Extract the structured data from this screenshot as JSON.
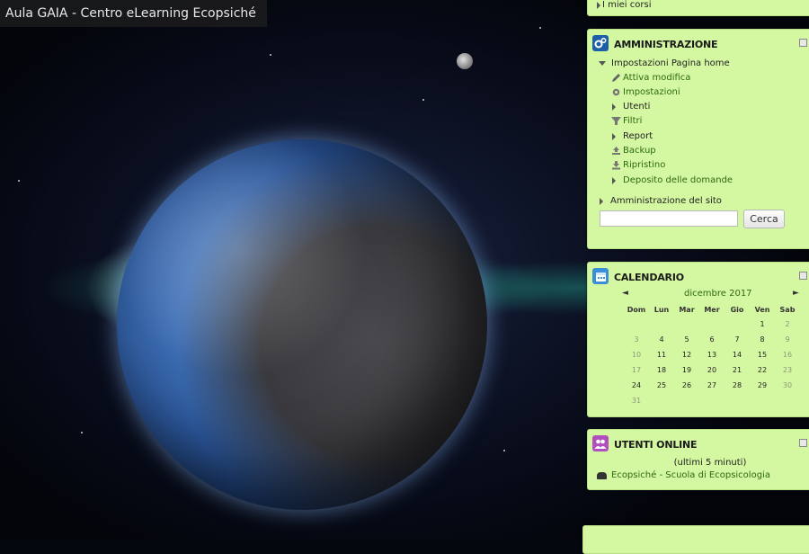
{
  "site_title": "Aula GAIA - Centro eLearning Ecopsiché",
  "top_block": {
    "link": "I miei corsi"
  },
  "admin": {
    "title": "AMMINISTRAZIONE",
    "section": "Impostazioni Pagina home",
    "items": [
      {
        "label": "Attiva modifica",
        "icon": "pencil-icon",
        "type": "link"
      },
      {
        "label": "Impostazioni",
        "icon": "gear-icon",
        "type": "link"
      },
      {
        "label": "Utenti",
        "icon": "arrow-right-icon",
        "type": "plain"
      },
      {
        "label": "Filtri",
        "icon": "filter-icon",
        "type": "link"
      },
      {
        "label": "Report",
        "icon": "arrow-right-icon",
        "type": "plain"
      },
      {
        "label": "Backup",
        "icon": "upload-icon",
        "type": "link"
      },
      {
        "label": "Ripristino",
        "icon": "download-icon",
        "type": "link"
      },
      {
        "label": "Deposito delle domande",
        "icon": "arrow-right-icon",
        "type": "link"
      }
    ],
    "site_admin": "Amministrazione del sito",
    "search": {
      "value": "",
      "button": "Cerca"
    },
    "icon_color": "#1c5fa6"
  },
  "calendar": {
    "title": "CALENDARIO",
    "month": "dicembre 2017",
    "prev": "◄",
    "next": "►",
    "weekdays": [
      "Dom",
      "Lun",
      "Mar",
      "Mer",
      "Gio",
      "Ven",
      "Sab"
    ],
    "weeks": [
      [
        "",
        "",
        "",
        "",
        "",
        "1",
        "2"
      ],
      [
        "3",
        "4",
        "5",
        "6",
        "7",
        "8",
        "9"
      ],
      [
        "10",
        "11",
        "12",
        "13",
        "14",
        "15",
        "16"
      ],
      [
        "17",
        "18",
        "19",
        "20",
        "21",
        "22",
        "23"
      ],
      [
        "24",
        "25",
        "26",
        "27",
        "28",
        "29",
        "30"
      ],
      [
        "31",
        "",
        "",
        "",
        "",
        "",
        ""
      ]
    ],
    "icon_color": "#3a8fd8"
  },
  "online": {
    "title": "UTENTI ONLINE",
    "subtitle": "(ultimi 5 minuti)",
    "user": "Ecopsiché - Scuola di Ecopsicologia",
    "icon_color": "#b24fbf"
  },
  "colors": {
    "block_bg": "#d4f7a1",
    "link": "#2d6a13"
  }
}
